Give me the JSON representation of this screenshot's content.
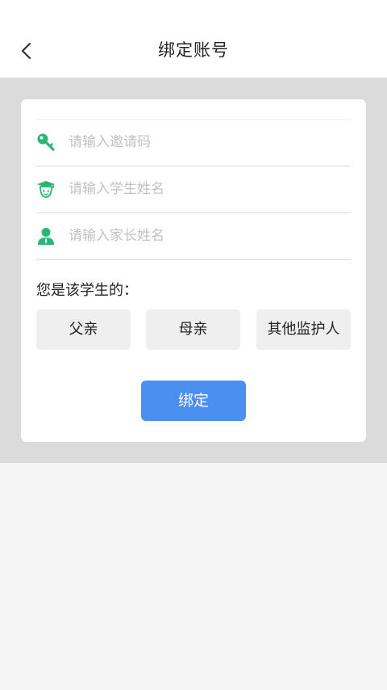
{
  "header": {
    "title": "绑定账号",
    "back_icon": "chevron-left-icon"
  },
  "form": {
    "invite_code_placeholder": "请输入邀请码",
    "student_name_placeholder": "请输入学生姓名",
    "parent_name_placeholder": "请输入家长姓名",
    "icons": {
      "invite_code": "key-icon",
      "student_name": "student-graduation-cap-icon",
      "parent_name": "person-icon"
    }
  },
  "relation": {
    "label": "您是该学生的：",
    "options": [
      "父亲",
      "母亲",
      "其他监护人"
    ]
  },
  "submit": {
    "label": "绑定"
  },
  "colors": {
    "accent": "#4b8ff0",
    "icon_green": "#2bb673",
    "band_gray": "#dbdbdb",
    "page_bg": "#f5f5f5"
  }
}
